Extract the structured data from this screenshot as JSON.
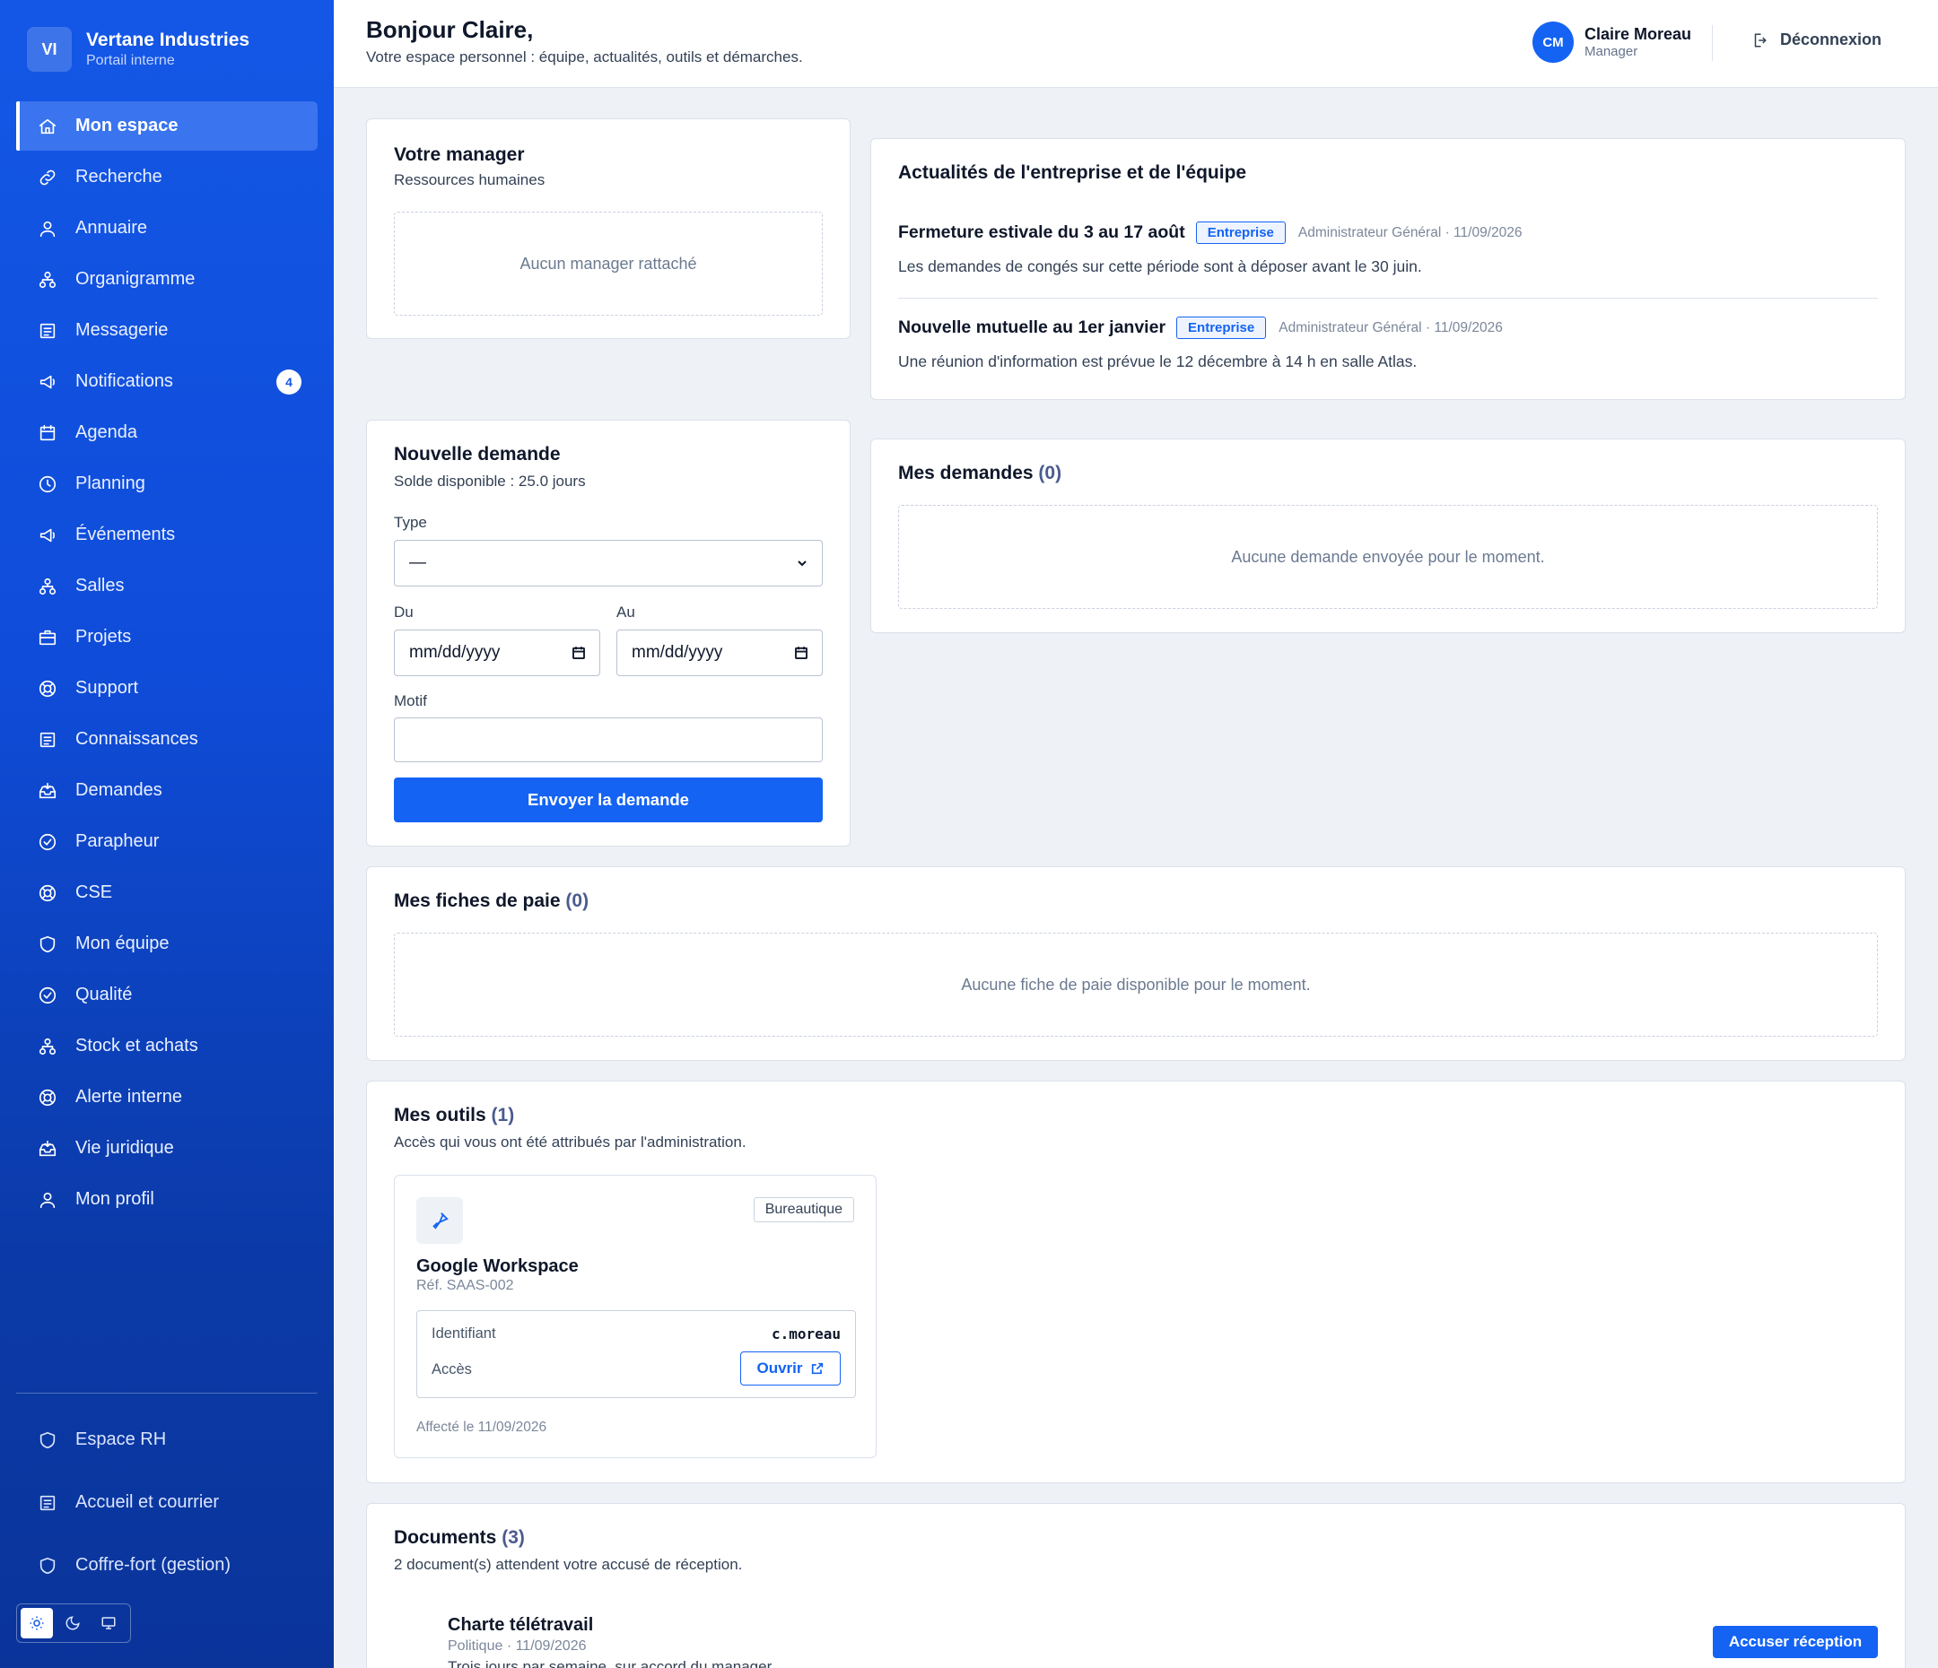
{
  "brand": {
    "initials": "VI",
    "name": "Vertane Industries",
    "subtitle": "Portail interne"
  },
  "nav": [
    {
      "label": "Mon espace",
      "icon": "home-icon",
      "active": true
    },
    {
      "label": "Recherche",
      "icon": "link-icon"
    },
    {
      "label": "Annuaire",
      "icon": "users-icon"
    },
    {
      "label": "Organigramme",
      "icon": "org-chart-icon"
    },
    {
      "label": "Messagerie",
      "icon": "document-icon"
    },
    {
      "label": "Notifications",
      "icon": "megaphone-icon",
      "badge": "4"
    },
    {
      "label": "Agenda",
      "icon": "calendar-icon"
    },
    {
      "label": "Planning",
      "icon": "clock-icon"
    },
    {
      "label": "Événements",
      "icon": "megaphone-icon"
    },
    {
      "label": "Salles",
      "icon": "org-chart-icon"
    },
    {
      "label": "Projets",
      "icon": "briefcase-icon"
    },
    {
      "label": "Support",
      "icon": "lifebuoy-icon"
    },
    {
      "label": "Connaissances",
      "icon": "document-icon"
    },
    {
      "label": "Demandes",
      "icon": "inbox-icon"
    },
    {
      "label": "Parapheur",
      "icon": "check-circle-icon"
    },
    {
      "label": "CSE",
      "icon": "lifebuoy-icon"
    },
    {
      "label": "Mon équipe",
      "icon": "shield-icon"
    },
    {
      "label": "Qualité",
      "icon": "check-circle-icon"
    },
    {
      "label": "Stock et achats",
      "icon": "org-chart-icon"
    },
    {
      "label": "Alerte interne",
      "icon": "lifebuoy-icon"
    },
    {
      "label": "Vie juridique",
      "icon": "inbox-icon"
    },
    {
      "label": "Mon profil",
      "icon": "user-icon"
    }
  ],
  "bottom_nav": [
    {
      "label": "Espace RH",
      "icon": "shield-icon"
    },
    {
      "label": "Accueil et courrier",
      "icon": "document-icon"
    },
    {
      "label": "Coffre-fort (gestion)",
      "icon": "shield-icon"
    }
  ],
  "theme_icons": [
    "sun-icon",
    "moon-icon",
    "monitor-icon"
  ],
  "header": {
    "greeting": "Bonjour Claire,",
    "subtitle": "Votre espace personnel : équipe, actualités, outils et démarches.",
    "user_initials": "CM",
    "user_name": "Claire Moreau",
    "user_role": "Manager",
    "logout_label": "Déconnexion"
  },
  "manager_card": {
    "title": "Votre manager",
    "subtitle": "Ressources humaines",
    "empty": "Aucun manager rattaché"
  },
  "news_card": {
    "title": "Actualités de l'entreprise et de l'équipe",
    "items": [
      {
        "title": "Fermeture estivale du 3 au 17 août",
        "tag": "Entreprise",
        "meta": "Administrateur Général · 11/09/2026",
        "text": "Les demandes de congés sur cette période sont à déposer avant le 30 juin."
      },
      {
        "title": "Nouvelle mutuelle au 1er janvier",
        "tag": "Entreprise",
        "meta": "Administrateur Général · 11/09/2026",
        "text": "Une réunion d'information est prévue le 12 décembre à 14 h en salle Atlas."
      }
    ]
  },
  "request_form": {
    "title": "Nouvelle demande",
    "balance": "Solde disponible : 25.0 jours",
    "type_label": "Type",
    "type_value": "—",
    "from_label": "Du",
    "from_value": "mm/dd/yyyy",
    "to_label": "Au",
    "to_value": "mm/dd/yyyy",
    "reason_label": "Motif",
    "reason_value": "",
    "submit_label": "Envoyer la demande"
  },
  "my_requests": {
    "title": "Mes demandes",
    "count": "(0)",
    "empty": "Aucune demande envoyée pour le moment."
  },
  "payslips": {
    "title": "Mes fiches de paie",
    "count": "(0)",
    "empty": "Aucune fiche de paie disponible pour le moment."
  },
  "tools": {
    "title": "Mes outils",
    "count": "(1)",
    "subtitle": "Accès qui vous ont été attribués par l'administration.",
    "items": [
      {
        "icon": "pen-icon",
        "category": "Bureautique",
        "name": "Google Workspace",
        "ref": "Réf. SAAS-002",
        "id_label": "Identifiant",
        "id_value": "c.moreau",
        "access_label": "Accès",
        "open_label": "Ouvrir",
        "assigned": "Affecté le 11/09/2026"
      }
    ]
  },
  "documents": {
    "title": "Documents",
    "count": "(3)",
    "subtitle": "2 document(s) attendent votre accusé de réception.",
    "items": [
      {
        "title": "Charte télétravail",
        "meta": "Politique · 11/09/2026",
        "text": "Trois jours par semaine, sur accord du manager.",
        "action": "Accuser réception"
      }
    ]
  },
  "colors": {
    "primary": "#1463f3",
    "sidebar": "#1457e6",
    "background": "#eef1f6"
  }
}
